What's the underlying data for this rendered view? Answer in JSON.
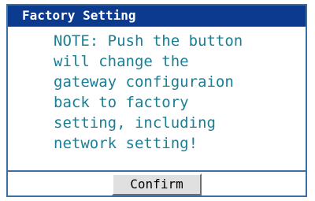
{
  "panel": {
    "title": "Factory Setting",
    "note_lines": [
      "NOTE: Push the button",
      "will change the",
      "gateway configuraion",
      "back to factory",
      "setting, including",
      "network setting!"
    ],
    "confirm_label": "Confirm"
  },
  "colors": {
    "title_bar_bg": "#0c3a8e",
    "title_text": "#ffffff",
    "note_text": "#1a7f95",
    "border": "#3a6fa8",
    "button_bg": "#e0e0e0"
  }
}
